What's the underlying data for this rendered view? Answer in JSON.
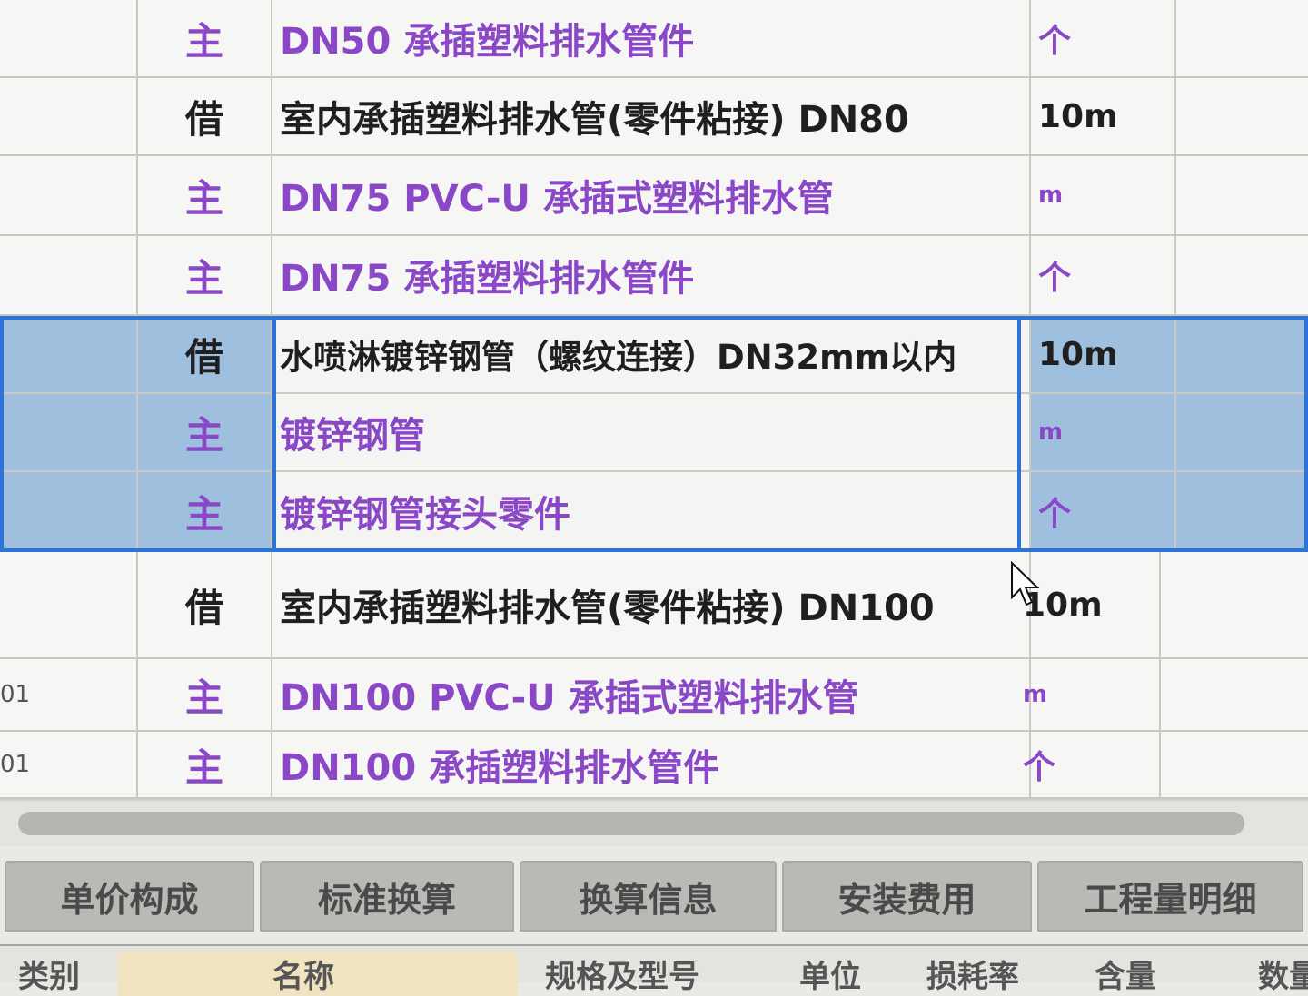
{
  "rows": [
    {
      "code": "",
      "type": "主",
      "name": "DN50 承插塑料排水管件",
      "unit": "个",
      "kind": "main"
    },
    {
      "code": "",
      "type": "借",
      "name": "室内承插塑料排水管(零件粘接) DN80",
      "unit": "10m",
      "kind": "borrow"
    },
    {
      "code": "",
      "type": "主",
      "name": "DN75 PVC-U 承插式塑料排水管",
      "unit": "m",
      "kind": "main"
    },
    {
      "code": "",
      "type": "主",
      "name": "DN75 承插塑料排水管件",
      "unit": "个",
      "kind": "main"
    },
    {
      "code": "",
      "type": "借",
      "name": "水喷淋镀锌钢管（螺纹连接）DN32mm以内",
      "unit": "10m",
      "kind": "borrow"
    },
    {
      "code": "",
      "type": "主",
      "name": "镀锌钢管",
      "unit": "m",
      "kind": "main"
    },
    {
      "code": "",
      "type": "主",
      "name": "镀锌钢管接头零件",
      "unit": "个",
      "kind": "main"
    },
    {
      "code": "",
      "type": "借",
      "name": "室内承插塑料排水管(零件粘接) DN100",
      "unit": "10m",
      "kind": "borrow"
    },
    {
      "code": "01",
      "type": "主",
      "name": "DN100 PVC-U 承插式塑料排水管",
      "unit": "m",
      "kind": "main"
    },
    {
      "code": "01",
      "type": "主",
      "name": "DN100 承插塑料排水管件",
      "unit": "个",
      "kind": "main"
    }
  ],
  "tabs": [
    "单价构成",
    "标准换算",
    "换算信息",
    "安装费用",
    "工程量明细"
  ],
  "subheader": [
    "类别",
    "名称",
    "规格及型号",
    "单位",
    "损耗率",
    "含量",
    "数量"
  ],
  "colors": {
    "main_text": "#8a48c7",
    "borrow_text": "#1f1f1f",
    "selection": "#9fbfdf",
    "selection_border": "#2c73d8"
  }
}
